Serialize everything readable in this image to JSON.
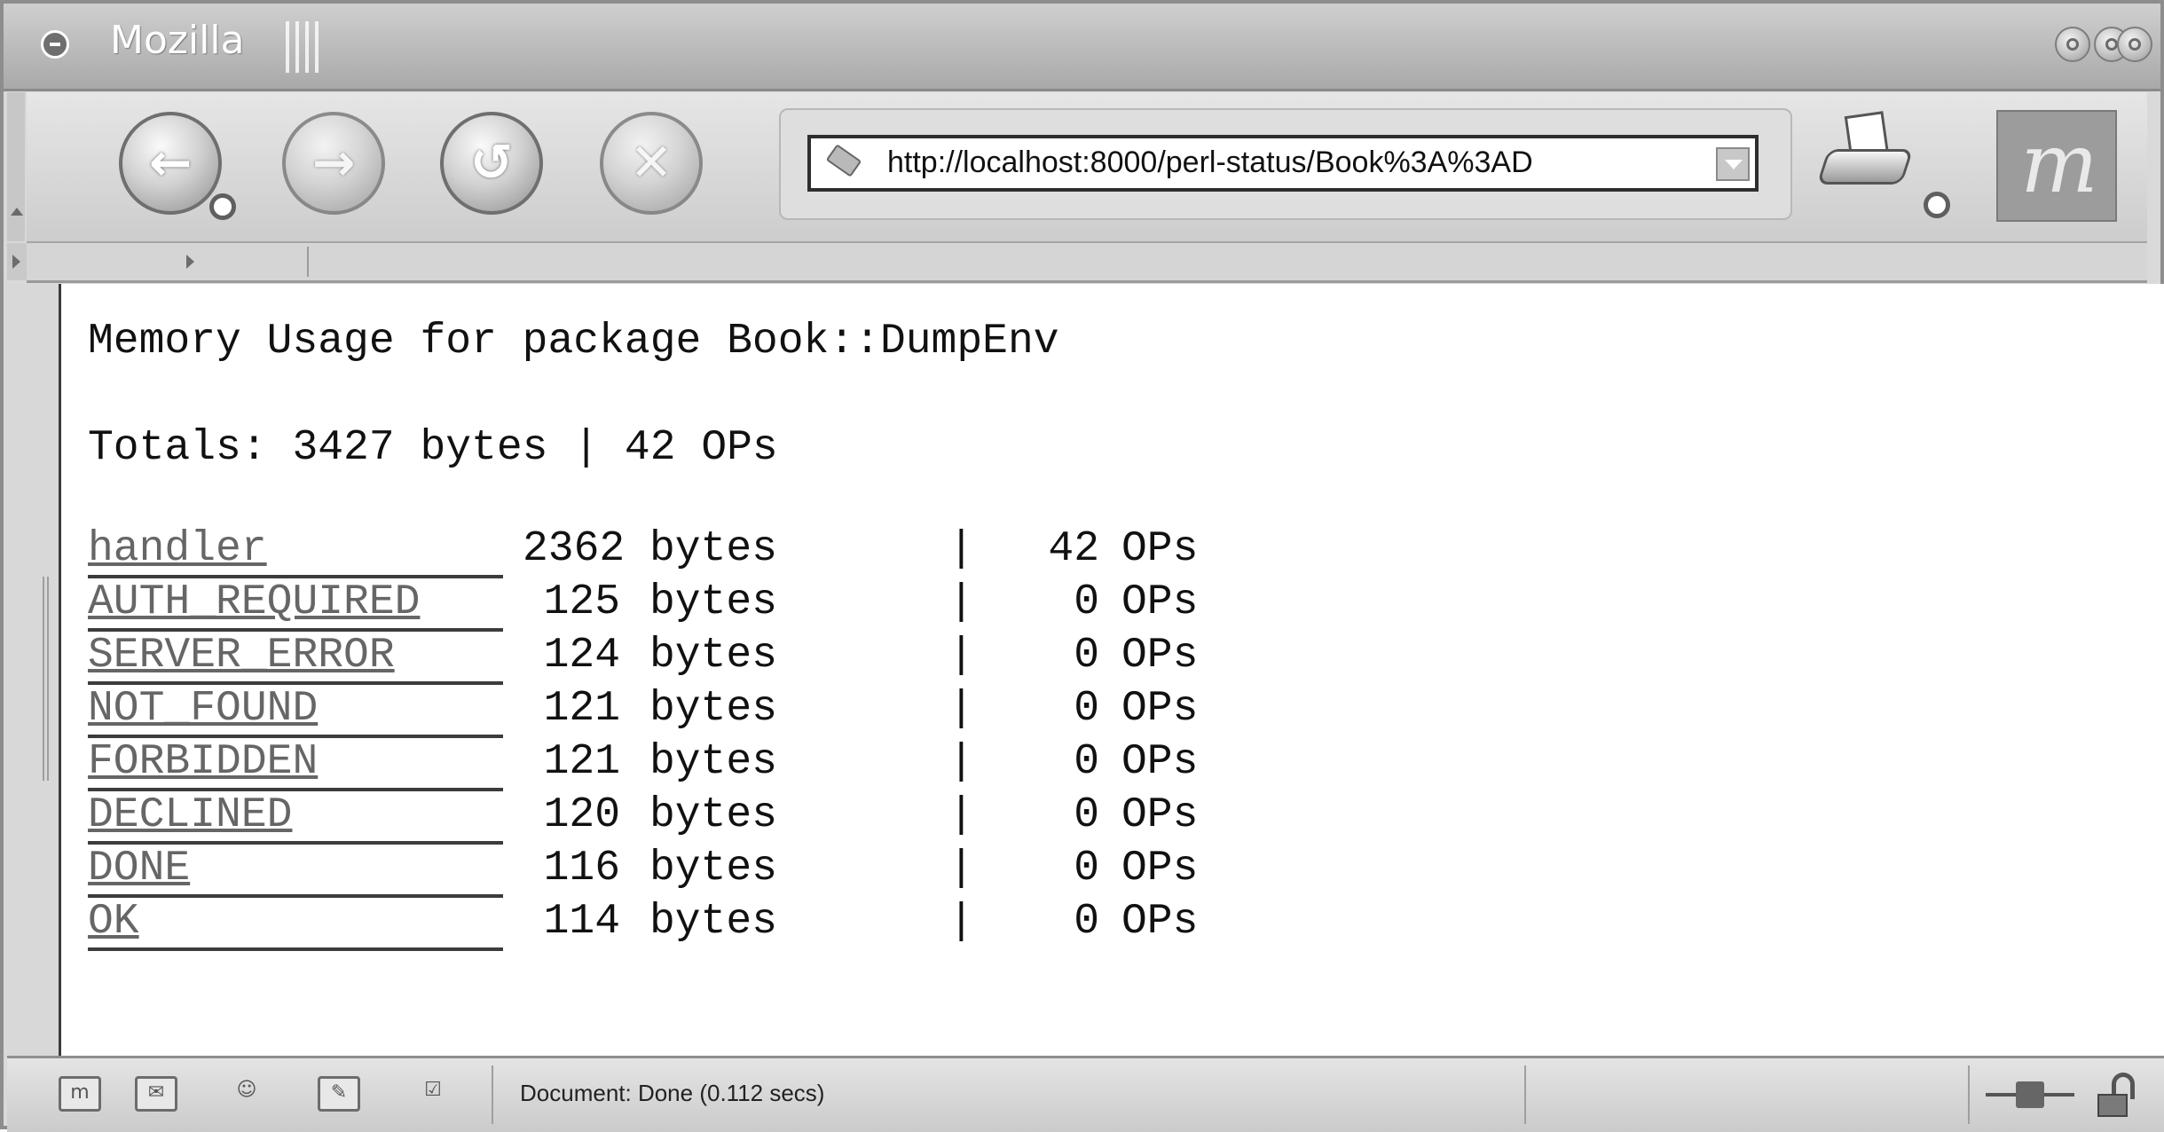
{
  "window": {
    "title": "Mozilla"
  },
  "toolbar": {
    "back_icon": "arrow-left",
    "forward_icon": "arrow-right",
    "reload_icon": "reload",
    "stop_icon": "x",
    "url": "http://localhost:8000/perl-status/Book%3A%3AD",
    "back_glyph": "←",
    "forward_glyph": "→",
    "reload_glyph": "↺",
    "stop_glyph": "✕",
    "logo_glyph": "m"
  },
  "page": {
    "heading": "Memory Usage for package Book::DumpEnv",
    "totals": "Totals: 3427 bytes | 42 OPs",
    "rows": [
      {
        "name": "handler",
        "bytes": "2362",
        "ops": "42"
      },
      {
        "name": "AUTH_REQUIRED",
        "bytes": "125",
        "ops": "0"
      },
      {
        "name": "SERVER_ERROR",
        "bytes": "124",
        "ops": "0"
      },
      {
        "name": "NOT_FOUND",
        "bytes": "121",
        "ops": "0"
      },
      {
        "name": "FORBIDDEN",
        "bytes": "121",
        "ops": "0"
      },
      {
        "name": "DECLINED",
        "bytes": "120",
        "ops": "0"
      },
      {
        "name": "DONE",
        "bytes": "116",
        "ops": "0"
      },
      {
        "name": "OK",
        "bytes": "114",
        "ops": "0"
      }
    ],
    "bytes_unit": "bytes",
    "separator": "|",
    "ops_unit": "OPs"
  },
  "statusbar": {
    "text": "Document: Done (0.112 secs)"
  },
  "colors": {
    "link": "#666666",
    "chrome": "#d9d9d9"
  }
}
